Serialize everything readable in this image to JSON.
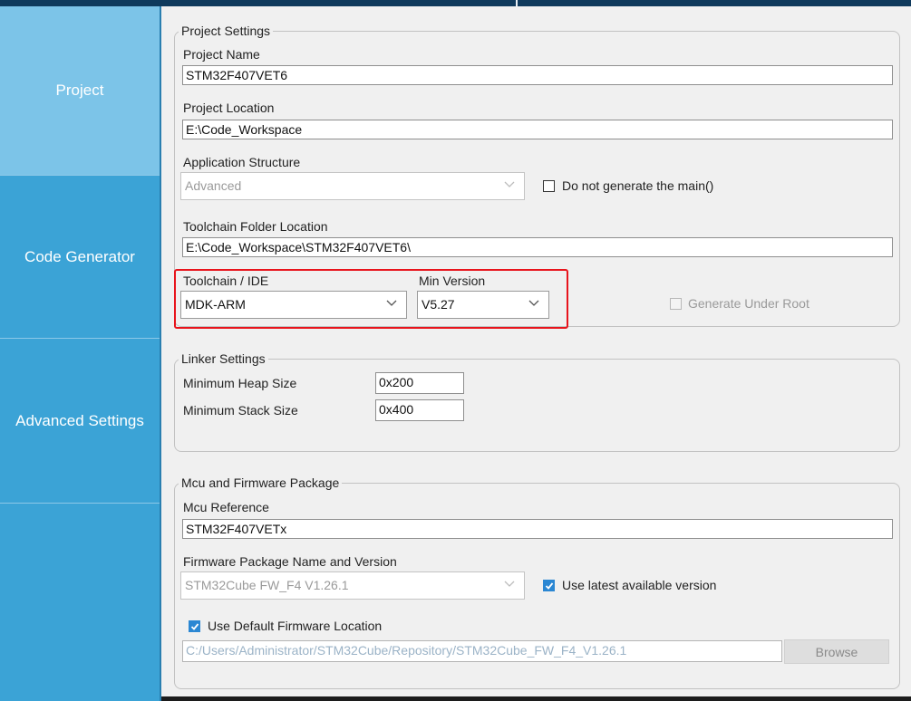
{
  "sidebar": {
    "items": [
      {
        "label": "Project",
        "active": true
      },
      {
        "label": "Code Generator",
        "active": false
      },
      {
        "label": "Advanced Settings",
        "active": false
      }
    ]
  },
  "project_settings": {
    "legend": "Project Settings",
    "project_name_label": "Project Name",
    "project_name_value": "STM32F407VET6",
    "project_location_label": "Project Location",
    "project_location_value": "E:\\Code_Workspace",
    "app_structure_label": "Application Structure",
    "app_structure_value": "Advanced",
    "no_main_label": "Do not generate the main()",
    "no_main_checked": false,
    "toolchain_folder_label": "Toolchain Folder Location",
    "toolchain_folder_value": "E:\\Code_Workspace\\STM32F407VET6\\",
    "toolchain_label": "Toolchain / IDE",
    "toolchain_value": "MDK-ARM",
    "min_version_label": "Min Version",
    "min_version_value": "V5.27",
    "generate_under_root_label": "Generate Under Root",
    "generate_under_root_checked": false
  },
  "linker_settings": {
    "legend": "Linker Settings",
    "heap_label": "Minimum Heap Size",
    "heap_value": "0x200",
    "stack_label": "Minimum Stack Size",
    "stack_value": "0x400"
  },
  "mcu_firmware": {
    "legend": "Mcu and Firmware Package",
    "mcu_ref_label": "Mcu Reference",
    "mcu_ref_value": "STM32F407VETx",
    "fw_name_label": "Firmware Package Name and Version",
    "fw_name_value": "STM32Cube FW_F4 V1.26.1",
    "use_latest_label": "Use latest available version",
    "use_latest_checked": true,
    "use_default_loc_label": "Use Default Firmware Location",
    "use_default_loc_checked": true,
    "fw_location_value": "C:/Users/Administrator/STM32Cube/Repository/STM32Cube_FW_F4_V1.26.1",
    "browse_label": "Browse"
  },
  "colors": {
    "sidebar": "#3ba3d6",
    "sidebar_active": "#7cc4e8",
    "highlight_box": "#e8141c",
    "checkbox_checked": "#2b87d3"
  },
  "icons": [
    "chevron-down-icon",
    "checkmark-icon"
  ]
}
